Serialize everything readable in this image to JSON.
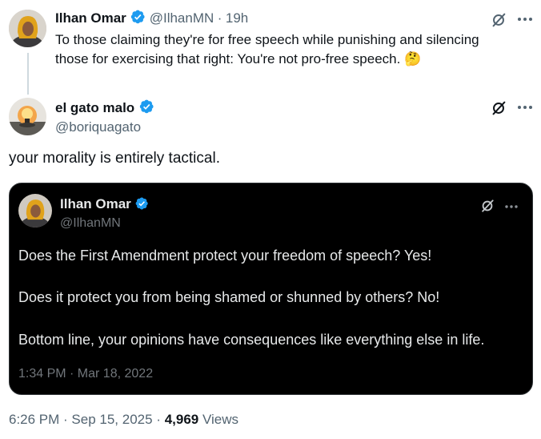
{
  "parent_tweet": {
    "author_name": "Ilhan Omar",
    "author_handle": "@IlhanMN",
    "separator": "·",
    "age": "19h",
    "text_line1": "To those claiming they're for free speech while punishing and silencing",
    "text_line2": "those for exercising that right: You're not pro-free speech.",
    "emoji": "🤔"
  },
  "main_tweet": {
    "author_name": "el gato malo",
    "author_handle": "@boriquagato",
    "text": "your morality is entirely tactical.",
    "quoted": {
      "author_name": "Ilhan Omar",
      "author_handle": "@IlhanMN",
      "line1": "Does the First Amendment protect your freedom of speech? Yes!",
      "line2": "Does it protect you from being shamed or shunned by others? No!",
      "line3": "Bottom line, your opinions have consequences like everything else in life.",
      "timestamp": "1:34 PM · Mar 18, 2022"
    },
    "timestamp": "6:26 PM · Sep 15, 2025",
    "dot": "·",
    "views_count": "4,969",
    "views_label": "Views"
  },
  "icons": {
    "verified": "verified-badge-icon",
    "grok": "grok-icon",
    "more": "more-icon"
  },
  "colors": {
    "verified_blue": "#1d9bf0",
    "secondary_text": "#536471",
    "quote_background": "#000000"
  }
}
